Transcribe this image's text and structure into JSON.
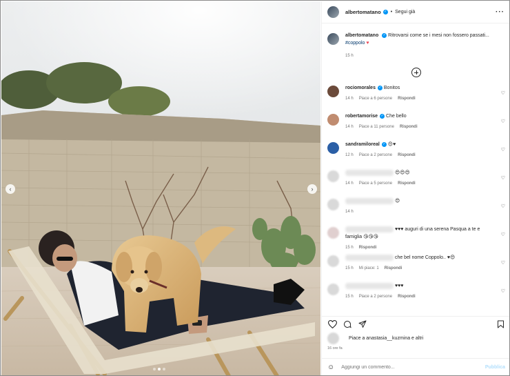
{
  "post": {
    "username": "albertomatano",
    "follow_label": "Segui già",
    "caption_text": "Ritrovarsi come se i mesi non fossero passati...",
    "hashtag": "#coppolo",
    "caption_emoji": "♥",
    "time": "15 h"
  },
  "comments": [
    {
      "user": "rociomorales",
      "text": "Bonitos",
      "time": "14 h",
      "likes": "Piace a 6 persone",
      "reply": "Rispondi",
      "avatar_color": "#6b4a3a",
      "blurred": false
    },
    {
      "user": "robertamorise",
      "text": "Che bello",
      "time": "14 h",
      "likes": "Piace a 11 persone",
      "reply": "Rispondi",
      "avatar_color": "#c08c70",
      "blurred": false
    },
    {
      "user": "sandramiloreal",
      "text": "😍♥",
      "time": "12 h",
      "likes": "Piace a 2 persone",
      "reply": "Rispondi",
      "avatar_color": "#2b5fa6",
      "blurred": false
    },
    {
      "user": "",
      "text": "😍😍😍",
      "time": "14 h",
      "likes": "Piace a 5 persone",
      "reply": "Rispondi",
      "avatar_color": "#d9d9d9",
      "blurred": true
    },
    {
      "user": "",
      "text": "😍",
      "time": "14 h",
      "likes": "",
      "reply": "",
      "avatar_color": "#d9d9d9",
      "blurred": true
    },
    {
      "user": "",
      "text": "♥♥♥ auguri di una serena Pasqua a te e famiglia 😘😘😘",
      "time": "15 h",
      "likes": "",
      "reply": "Rispondi",
      "avatar_color": "#e0cfcf",
      "blurred": true
    },
    {
      "user": "",
      "text": "che bel nome Coppolo.. ♥😍",
      "time": "15 h",
      "likes": "Mi piace: 1",
      "reply": "Rispondi",
      "avatar_color": "#d9d9d9",
      "blurred": true
    },
    {
      "user": "",
      "text": "♥♥♥",
      "time": "15 h",
      "likes": "Piace a 2 persone",
      "reply": "Rispondi",
      "avatar_color": "#d9d9d9",
      "blurred": true
    }
  ],
  "footer": {
    "liked_by": "Piace a anastasia__kuzmina e altri",
    "date": "16 ore fa",
    "comment_placeholder": "Aggiungi un commento...",
    "publish_label": "Pubblica"
  },
  "colors": {
    "accent": "#0095f6",
    "heart": "#ed4956",
    "muted": "#737373"
  }
}
